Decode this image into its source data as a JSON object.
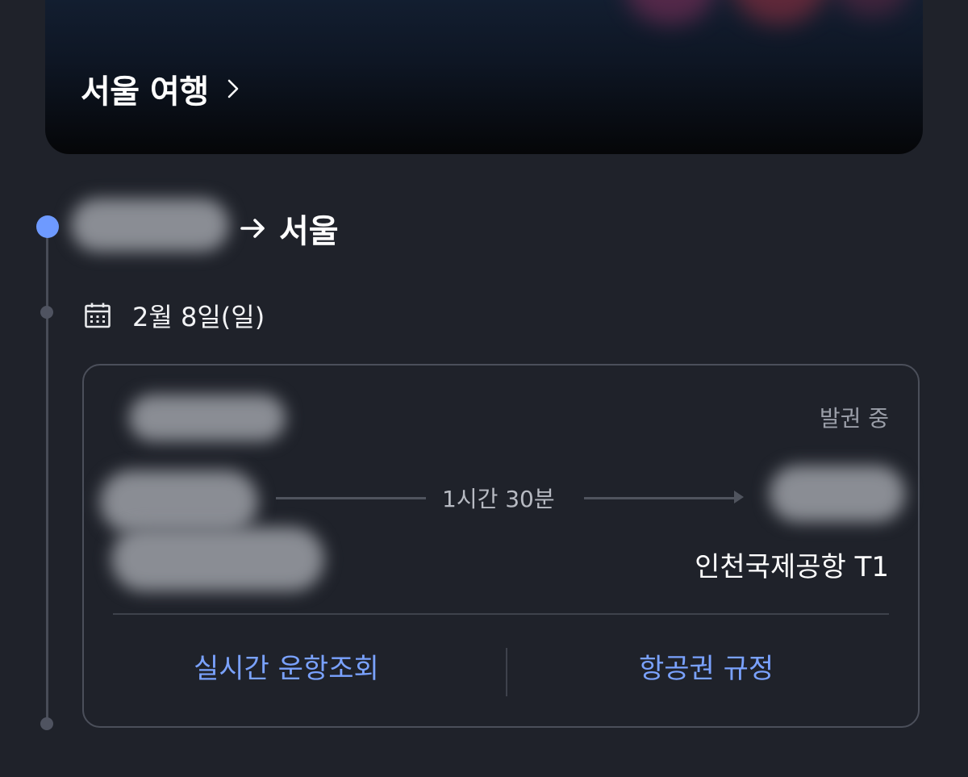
{
  "banner": {
    "title": "서울 여행",
    "chevron_icon": "chevron-right-icon"
  },
  "route": {
    "arrow_icon": "arrow-right-icon",
    "destination": "서울"
  },
  "date": {
    "icon": "calendar-icon",
    "label": "2월 8일(일)"
  },
  "flight": {
    "status": "발권 중",
    "duration": "1시간 30분",
    "arrival_airport": "인천국제공항 T1"
  },
  "actions": {
    "realtime": "실시간 운항조회",
    "rules": "항공권 규정"
  },
  "colors": {
    "background": "#1f222a",
    "accent": "#7aa2ff",
    "timeline_dot": "#6e9aff"
  }
}
